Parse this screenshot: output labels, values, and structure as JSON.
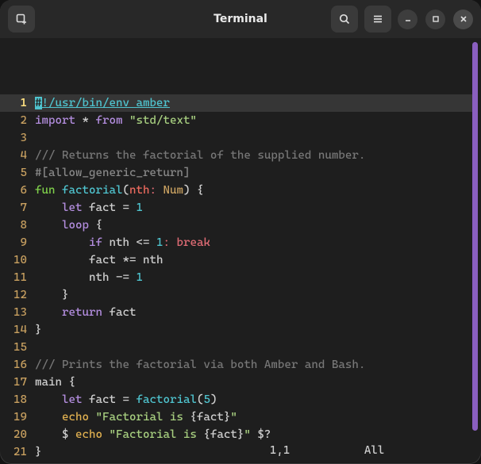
{
  "window": {
    "title": "Terminal"
  },
  "status": {
    "pos": "1,1",
    "scroll": "All"
  },
  "source": {
    "lines": [
      {
        "n": 1,
        "cursor": true,
        "tokens": [
          {
            "t": "#",
            "c": "cursor-bg"
          },
          {
            "t": "!/usr/bin/env amber",
            "c": "shebang"
          }
        ]
      },
      {
        "n": 2,
        "tokens": [
          {
            "t": "import",
            "c": "kw"
          },
          {
            "t": " "
          },
          {
            "t": "*",
            "c": "op"
          },
          {
            "t": " "
          },
          {
            "t": "from",
            "c": "kw"
          },
          {
            "t": " "
          },
          {
            "t": "\"std/text\"",
            "c": "str"
          }
        ]
      },
      {
        "n": 3,
        "tokens": []
      },
      {
        "n": 4,
        "tokens": [
          {
            "t": "/// Returns the factorial of the supplied number.",
            "c": "cmt"
          }
        ]
      },
      {
        "n": 5,
        "tokens": [
          {
            "t": "#[allow_generic_return]",
            "c": "attr"
          }
        ]
      },
      {
        "n": 6,
        "tokens": [
          {
            "t": "fun",
            "c": "fn-kw"
          },
          {
            "t": " "
          },
          {
            "t": "factorial",
            "c": "fn-name"
          },
          {
            "t": "(",
            "c": "punc"
          },
          {
            "t": "nth",
            "c": "param"
          },
          {
            "t": ":",
            "c": "colon-pink"
          },
          {
            "t": " "
          },
          {
            "t": "Num",
            "c": "type"
          },
          {
            "t": ")",
            "c": "punc"
          },
          {
            "t": " "
          },
          {
            "t": "{",
            "c": "brace"
          }
        ]
      },
      {
        "n": 7,
        "tokens": [
          {
            "t": "    "
          },
          {
            "t": "let",
            "c": "kw"
          },
          {
            "t": " ",
            "c": ""
          },
          {
            "t": "fact",
            "c": "var"
          },
          {
            "t": " "
          },
          {
            "t": "=",
            "c": "op"
          },
          {
            "t": " "
          },
          {
            "t": "1",
            "c": "num"
          }
        ]
      },
      {
        "n": 8,
        "tokens": [
          {
            "t": "    "
          },
          {
            "t": "loop",
            "c": "kw"
          },
          {
            "t": " "
          },
          {
            "t": "{",
            "c": "brace"
          }
        ]
      },
      {
        "n": 9,
        "tokens": [
          {
            "t": "        "
          },
          {
            "t": "if",
            "c": "kw"
          },
          {
            "t": " "
          },
          {
            "t": "nth",
            "c": "var"
          },
          {
            "t": " "
          },
          {
            "t": "<= ",
            "c": "op"
          },
          {
            "t": "1",
            "c": "num"
          },
          {
            "t": ":",
            "c": "colon-pink"
          },
          {
            "t": " "
          },
          {
            "t": "break",
            "c": "break-kw"
          }
        ]
      },
      {
        "n": 10,
        "tokens": [
          {
            "t": "        "
          },
          {
            "t": "fact",
            "c": "var"
          },
          {
            "t": " "
          },
          {
            "t": "*= ",
            "c": "op"
          },
          {
            "t": "nth",
            "c": "var"
          }
        ]
      },
      {
        "n": 11,
        "tokens": [
          {
            "t": "        "
          },
          {
            "t": "nth",
            "c": "var"
          },
          {
            "t": " "
          },
          {
            "t": "-= ",
            "c": "op"
          },
          {
            "t": "1",
            "c": "num"
          }
        ]
      },
      {
        "n": 12,
        "tokens": [
          {
            "t": "    "
          },
          {
            "t": "}",
            "c": "brace"
          }
        ]
      },
      {
        "n": 13,
        "tokens": [
          {
            "t": "    "
          },
          {
            "t": "return",
            "c": "kw"
          },
          {
            "t": " "
          },
          {
            "t": "fact",
            "c": "var"
          }
        ]
      },
      {
        "n": 14,
        "tokens": [
          {
            "t": "}",
            "c": "brace"
          }
        ]
      },
      {
        "n": 15,
        "tokens": []
      },
      {
        "n": 16,
        "tokens": [
          {
            "t": "/// Prints the factorial via both Amber and Bash.",
            "c": "cmt"
          }
        ]
      },
      {
        "n": 17,
        "tokens": [
          {
            "t": "main",
            "c": "main-kw"
          },
          {
            "t": " "
          },
          {
            "t": "{",
            "c": "brace"
          }
        ]
      },
      {
        "n": 18,
        "tokens": [
          {
            "t": "    "
          },
          {
            "t": "let",
            "c": "kw"
          },
          {
            "t": " "
          },
          {
            "t": "fact",
            "c": "var"
          },
          {
            "t": " "
          },
          {
            "t": "=",
            "c": "op"
          },
          {
            "t": " "
          },
          {
            "t": "factorial",
            "c": "fn-name"
          },
          {
            "t": "(",
            "c": "punc"
          },
          {
            "t": "5",
            "c": "num"
          },
          {
            "t": ")",
            "c": "punc"
          }
        ]
      },
      {
        "n": 19,
        "tokens": [
          {
            "t": "    "
          },
          {
            "t": "echo",
            "c": "echo"
          },
          {
            "t": " "
          },
          {
            "t": "\"Factorial is ",
            "c": "str"
          },
          {
            "t": "{",
            "c": "var"
          },
          {
            "t": "fact",
            "c": "var"
          },
          {
            "t": "}",
            "c": "var"
          },
          {
            "t": "\"",
            "c": "str"
          }
        ]
      },
      {
        "n": 20,
        "tokens": [
          {
            "t": "    "
          },
          {
            "t": "$",
            "c": "dollar"
          },
          {
            "t": " "
          },
          {
            "t": "echo",
            "c": "echo"
          },
          {
            "t": " "
          },
          {
            "t": "\"Factorial is ",
            "c": "str"
          },
          {
            "t": "{",
            "c": "var"
          },
          {
            "t": "fact",
            "c": "var"
          },
          {
            "t": "}",
            "c": "var"
          },
          {
            "t": "\"",
            "c": "str"
          },
          {
            "t": " "
          },
          {
            "t": "$",
            "c": "dollar"
          },
          {
            "t": "?",
            "c": "var"
          }
        ]
      },
      {
        "n": 21,
        "tokens": [
          {
            "t": "}",
            "c": "brace"
          }
        ]
      }
    ]
  }
}
